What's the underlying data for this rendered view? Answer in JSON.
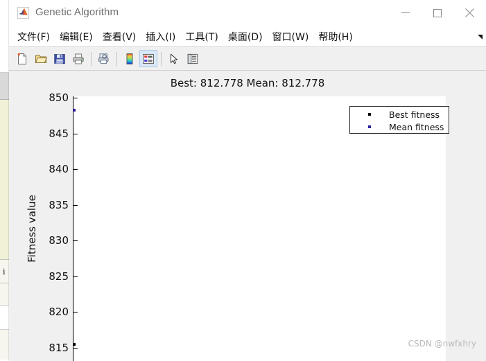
{
  "window": {
    "title": "Genetic Algorithm",
    "app_icon": "matlab-logo-icon",
    "controls": {
      "minimize": "—",
      "maximize": "□",
      "close": "×"
    }
  },
  "menu": {
    "items": [
      {
        "label": "文件(F)",
        "name": "menu-file"
      },
      {
        "label": "编辑(E)",
        "name": "menu-edit"
      },
      {
        "label": "查看(V)",
        "name": "menu-view"
      },
      {
        "label": "插入(I)",
        "name": "menu-insert"
      },
      {
        "label": "工具(T)",
        "name": "menu-tools"
      },
      {
        "label": "桌面(D)",
        "name": "menu-desktop"
      },
      {
        "label": "窗口(W)",
        "name": "menu-window"
      },
      {
        "label": "帮助(H)",
        "name": "menu-help"
      }
    ],
    "overflow_icon": "chevron-overflow-icon"
  },
  "toolbar": {
    "buttons": [
      {
        "name": "new-figure-button",
        "icon": "new-document-icon"
      },
      {
        "name": "open-file-button",
        "icon": "open-folder-icon"
      },
      {
        "name": "save-figure-button",
        "icon": "save-disk-icon"
      },
      {
        "name": "print-figure-button",
        "icon": "printer-icon"
      },
      {
        "name": "print-preview-button",
        "icon": "print-preview-icon"
      },
      {
        "name": "insert-colorbar-button",
        "icon": "colorbar-icon"
      },
      {
        "name": "insert-legend-button",
        "icon": "legend-icon",
        "active": true
      },
      {
        "name": "edit-plot-button",
        "icon": "arrow-pointer-icon"
      },
      {
        "name": "property-inspector-button",
        "icon": "property-inspector-icon"
      }
    ]
  },
  "background_window": {
    "visible_letter": "i"
  },
  "watermark": "CSDN @nwfxhry",
  "chart_data": {
    "type": "scatter",
    "title": "Best: 812.778 Mean: 812.778",
    "xlabel": "",
    "ylabel": "Fitness value",
    "ylim": [
      813.0,
      850.0
    ],
    "y_ticks": [
      850,
      845,
      840,
      835,
      830,
      825,
      820,
      815
    ],
    "y_tick_labels": [
      "850",
      "845",
      "840",
      "835",
      "830",
      "825",
      "820",
      "815"
    ],
    "grid": false,
    "legend_position": "upper-right",
    "legend": [
      {
        "name": "Best fitness",
        "color": "#000000",
        "marker": "square"
      },
      {
        "name": "Mean fitness",
        "color": "#2b1f9e",
        "marker": "square"
      }
    ],
    "series": [
      {
        "name": "Best fitness",
        "color": "#000000",
        "x": [
          0
        ],
        "values": [
          815.2
        ]
      },
      {
        "name": "Mean fitness",
        "color": "#2b1f9e",
        "x": [
          0
        ],
        "values": [
          848.2
        ]
      }
    ],
    "annotations": {
      "best": 812.778,
      "mean": 812.778
    }
  }
}
